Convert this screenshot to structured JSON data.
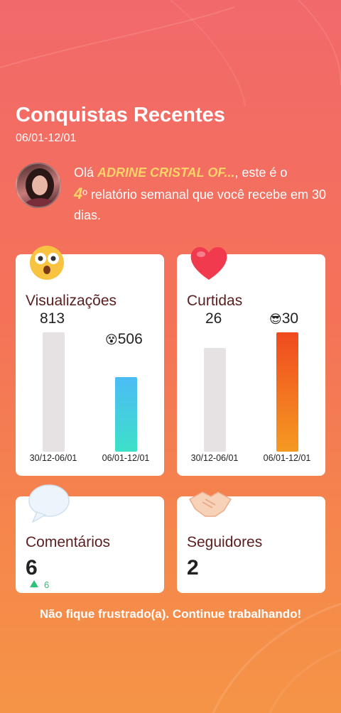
{
  "header": {
    "title": "Conquistas Recentes",
    "date_range": "06/01-12/01"
  },
  "greeting": {
    "prefix": "Olá ",
    "username": "ADRINE CRISTAL OF...",
    "middle": ", este é o ",
    "report_number": "4",
    "ordinal": "º",
    "suffix": " relatório semanal que você recebe em 30 dias."
  },
  "cards": {
    "views": {
      "title": "Visualizações",
      "icon": "surprised-face-icon",
      "previous_value": "813",
      "current_value": "506",
      "current_emoji": "😵",
      "previous_label": "30/12-06/01",
      "current_label": "06/01-12/01",
      "bar_colors": [
        "#4cbcf5",
        "#3de0c9"
      ]
    },
    "likes": {
      "title": "Curtidas",
      "icon": "heart-icon",
      "previous_value": "26",
      "current_value": "30",
      "current_emoji": "😎",
      "previous_label": "30/12-06/01",
      "current_label": "06/01-12/01",
      "bar_colors": [
        "#f04a1f",
        "#f59a22"
      ]
    },
    "comments": {
      "title": "Comentários",
      "icon": "speech-bubble-icon",
      "value": "6",
      "delta": "6",
      "delta_color": "#2fc27a"
    },
    "followers": {
      "title": "Seguidores",
      "icon": "handshake-icon",
      "value": "2"
    }
  },
  "chart_data": [
    {
      "type": "bar",
      "title": "Visualizações",
      "categories": [
        "30/12-06/01",
        "06/01-12/01"
      ],
      "values": [
        813,
        506
      ]
    },
    {
      "type": "bar",
      "title": "Curtidas",
      "categories": [
        "30/12-06/01",
        "06/01-12/01"
      ],
      "values": [
        26,
        30
      ]
    }
  ],
  "footer": {
    "message": "Não fique frustrado(a). Continue trabalhando!"
  }
}
